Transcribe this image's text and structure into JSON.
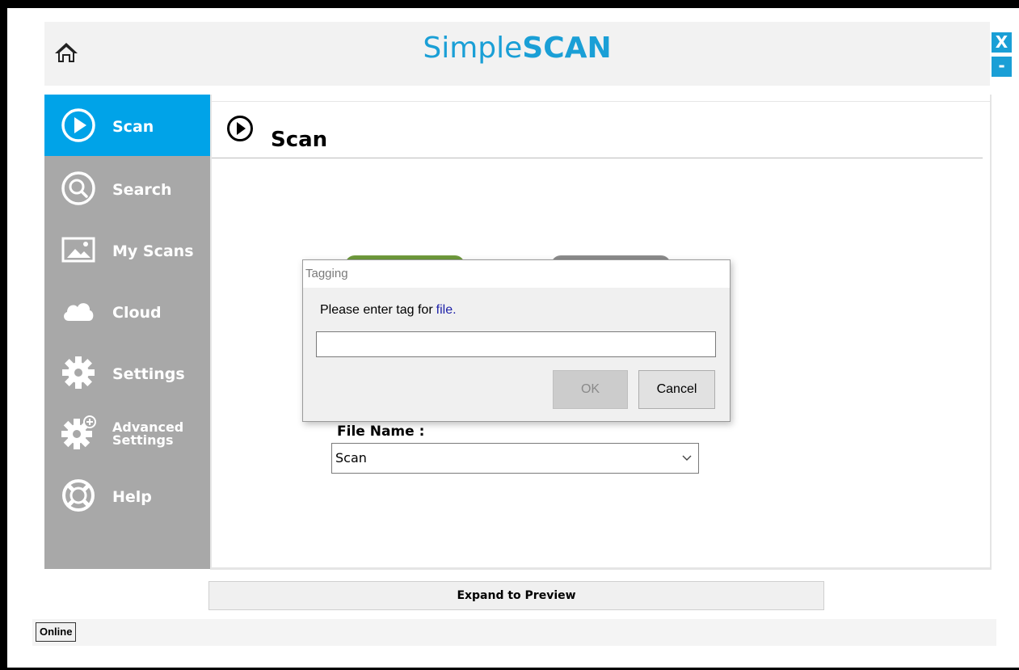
{
  "app": {
    "title_part1": "Simple",
    "title_part2": "SCAN",
    "close_label": "X",
    "minimize_label": "-"
  },
  "sidebar": {
    "items": [
      {
        "label": "Scan",
        "icon": "play-circle-icon",
        "active": true
      },
      {
        "label": "Search",
        "icon": "search-icon",
        "active": false
      },
      {
        "label": "My Scans",
        "icon": "image-icon",
        "active": false
      },
      {
        "label": "Cloud",
        "icon": "cloud-icon",
        "active": false
      },
      {
        "label": "Settings",
        "icon": "gear-icon",
        "active": false
      },
      {
        "label_line1": "Advanced",
        "label_line2": "Settings",
        "icon": "gear-plus-icon",
        "active": false
      },
      {
        "label": "Help",
        "icon": "lifebuoy-icon",
        "active": false
      }
    ]
  },
  "main": {
    "page_title": "Scan",
    "file_name_label": "File Name :",
    "file_name_value": "Scan"
  },
  "dialog": {
    "title": "Tagging",
    "message": "Please enter tag for",
    "message_accent": "file.",
    "input_value": "",
    "ok_label": "OK",
    "cancel_label": "Cancel"
  },
  "footer": {
    "expand_label": "Expand to Preview",
    "status": "Online"
  },
  "colors": {
    "accent": "#00a3e8",
    "sidebar": "#a8a8a8",
    "title_blue": "#1a9fd6"
  }
}
